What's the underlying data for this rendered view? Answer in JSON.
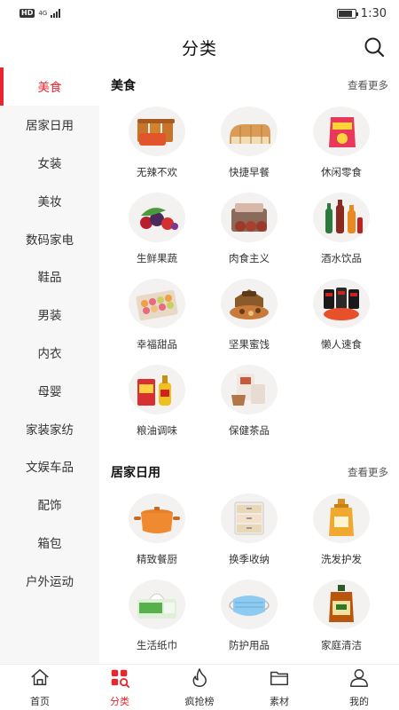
{
  "status_bar": {
    "hd": "HD",
    "network": "4G",
    "time": "1:30",
    "battery_level": 0.85
  },
  "header": {
    "title": "分类",
    "search_icon": "search-icon"
  },
  "colors": {
    "accent": "#e8262d",
    "sidebar_bg": "#f7f7f7"
  },
  "sidebar": {
    "items": [
      {
        "label": "美食",
        "active": true
      },
      {
        "label": "居家日用"
      },
      {
        "label": "女装"
      },
      {
        "label": "美妆"
      },
      {
        "label": "数码家电"
      },
      {
        "label": "鞋品"
      },
      {
        "label": "男装"
      },
      {
        "label": "内衣"
      },
      {
        "label": "母婴"
      },
      {
        "label": "家装家纺"
      },
      {
        "label": "文娱车品"
      },
      {
        "label": "配饰"
      },
      {
        "label": "箱包"
      },
      {
        "label": "户外运动"
      }
    ]
  },
  "sections": [
    {
      "title": "美食",
      "more": "查看更多",
      "items": [
        {
          "label": "无辣不欢",
          "icon": "spicy-snack-icon"
        },
        {
          "label": "快捷早餐",
          "icon": "bread-icon"
        },
        {
          "label": "休闲零食",
          "icon": "chips-bag-icon"
        },
        {
          "label": "生鲜果蔬",
          "icon": "fresh-fruit-icon"
        },
        {
          "label": "肉食主义",
          "icon": "meat-icon"
        },
        {
          "label": "酒水饮品",
          "icon": "drinks-icon"
        },
        {
          "label": "幸福甜品",
          "icon": "macaron-icon"
        },
        {
          "label": "坚果蜜饯",
          "icon": "nuts-box-icon"
        },
        {
          "label": "懒人速食",
          "icon": "instant-noodle-icon"
        },
        {
          "label": "粮油调味",
          "icon": "rice-oil-icon"
        },
        {
          "label": "保健茶品",
          "icon": "tea-icon"
        }
      ]
    },
    {
      "title": "居家日用",
      "more": "查看更多",
      "items": [
        {
          "label": "精致餐厨",
          "icon": "cooking-pot-icon"
        },
        {
          "label": "换季收纳",
          "icon": "storage-drawer-icon"
        },
        {
          "label": "洗发护发",
          "icon": "shampoo-bottle-icon"
        },
        {
          "label": "生活纸巾",
          "icon": "tissue-icon"
        },
        {
          "label": "防护用品",
          "icon": "face-mask-icon"
        },
        {
          "label": "家庭清洁",
          "icon": "disinfectant-icon"
        }
      ]
    }
  ],
  "tabbar": {
    "items": [
      {
        "label": "首页",
        "icon": "home-icon"
      },
      {
        "label": "分类",
        "icon": "category-icon",
        "active": true
      },
      {
        "label": "疯抢榜",
        "icon": "fire-icon"
      },
      {
        "label": "素材",
        "icon": "folder-icon"
      },
      {
        "label": "我的",
        "icon": "user-icon"
      }
    ]
  }
}
